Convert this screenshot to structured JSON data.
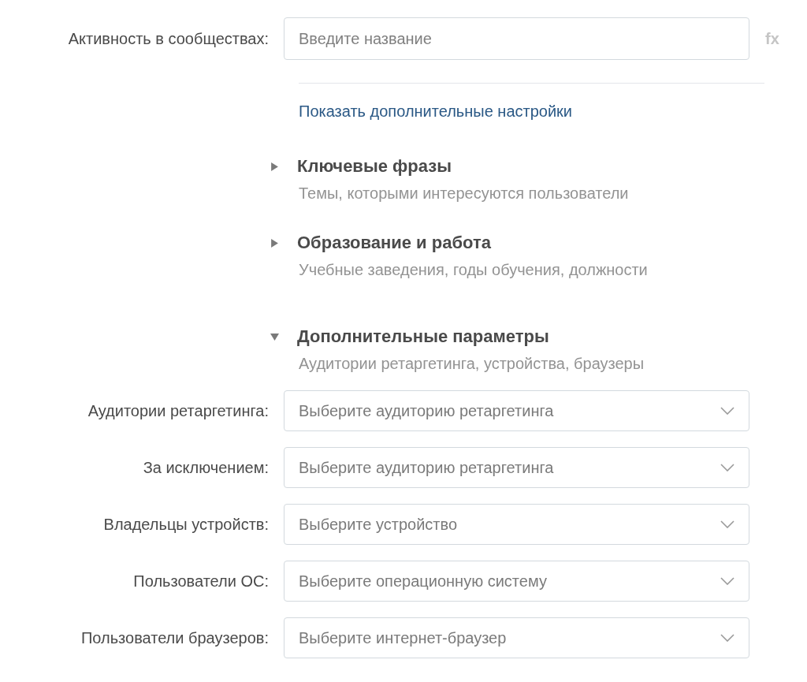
{
  "community_activity": {
    "label": "Активность в сообществах:",
    "placeholder": "Введите название",
    "formula_button": "fx"
  },
  "more_settings_link": "Показать дополнительные настройки",
  "sections": [
    {
      "title": "Ключевые фразы",
      "subtitle": "Темы, которыми интересуются пользователи",
      "expanded": false
    },
    {
      "title": "Образование и работа",
      "subtitle": "Учебные заведения, годы обучения, должности",
      "expanded": false
    },
    {
      "title": "Дополнительные параметры",
      "subtitle": "Аудитории ретаргетинга, устройства, браузеры",
      "expanded": true
    }
  ],
  "selects": [
    {
      "label": "Аудитории ретаргетинга:",
      "placeholder": "Выберите аудиторию ретаргетинга"
    },
    {
      "label": "За исключением:",
      "placeholder": "Выберите аудиторию ретаргетинга"
    },
    {
      "label": "Владельцы устройств:",
      "placeholder": "Выберите устройство"
    },
    {
      "label": "Пользователи ОС:",
      "placeholder": "Выберите операционную систему"
    },
    {
      "label": "Пользователи браузеров:",
      "placeholder": "Выберите интернет-браузер"
    }
  ]
}
